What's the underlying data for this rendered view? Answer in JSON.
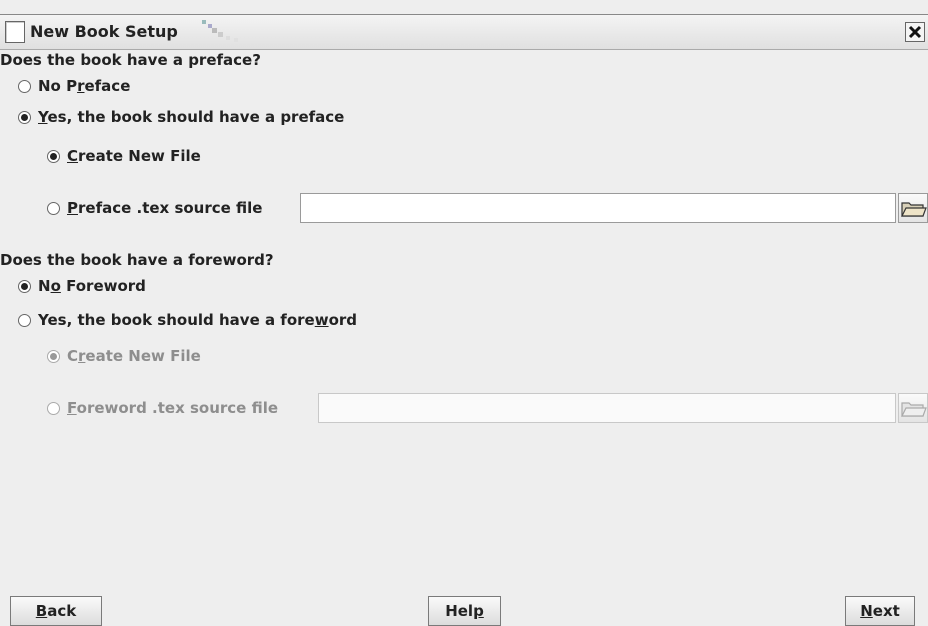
{
  "window": {
    "title": "New Book Setup"
  },
  "preface": {
    "question": "Does the book have a preface?",
    "no_option": {
      "before": "No P",
      "mnemonic": "r",
      "after": "eface",
      "selected": false
    },
    "yes_option": {
      "before": "",
      "mnemonic": "Y",
      "after": "es, the book should have a preface",
      "selected": true
    },
    "create_new": {
      "before": "",
      "mnemonic": "C",
      "after": "reate New File",
      "selected": true
    },
    "source_file": {
      "before": "",
      "mnemonic": "P",
      "after": "reface .tex source file",
      "selected": false,
      "value": ""
    }
  },
  "foreword": {
    "question": "Does the book have a foreword?",
    "no_option": {
      "before": "N",
      "mnemonic": "o",
      "after": " Foreword",
      "selected": true
    },
    "yes_option": {
      "before": "Yes, the book should have a fore",
      "mnemonic": "w",
      "after": "ord",
      "selected": false
    },
    "create_new": {
      "before": "C",
      "mnemonic": "r",
      "after": "eate New File",
      "selected": true,
      "enabled": false
    },
    "source_file": {
      "before": "",
      "mnemonic": "F",
      "after": "oreword .tex source file",
      "selected": false,
      "value": "",
      "enabled": false
    }
  },
  "buttons": {
    "back": {
      "before": "",
      "mnemonic": "B",
      "after": "ack"
    },
    "help": {
      "before": "Hel",
      "mnemonic": "p",
      "after": ""
    },
    "next": {
      "before": "",
      "mnemonic": "N",
      "after": "ext"
    }
  },
  "icons": {
    "window_icon": "window-icon",
    "close": "close-icon",
    "browse": "folder-open-icon"
  }
}
